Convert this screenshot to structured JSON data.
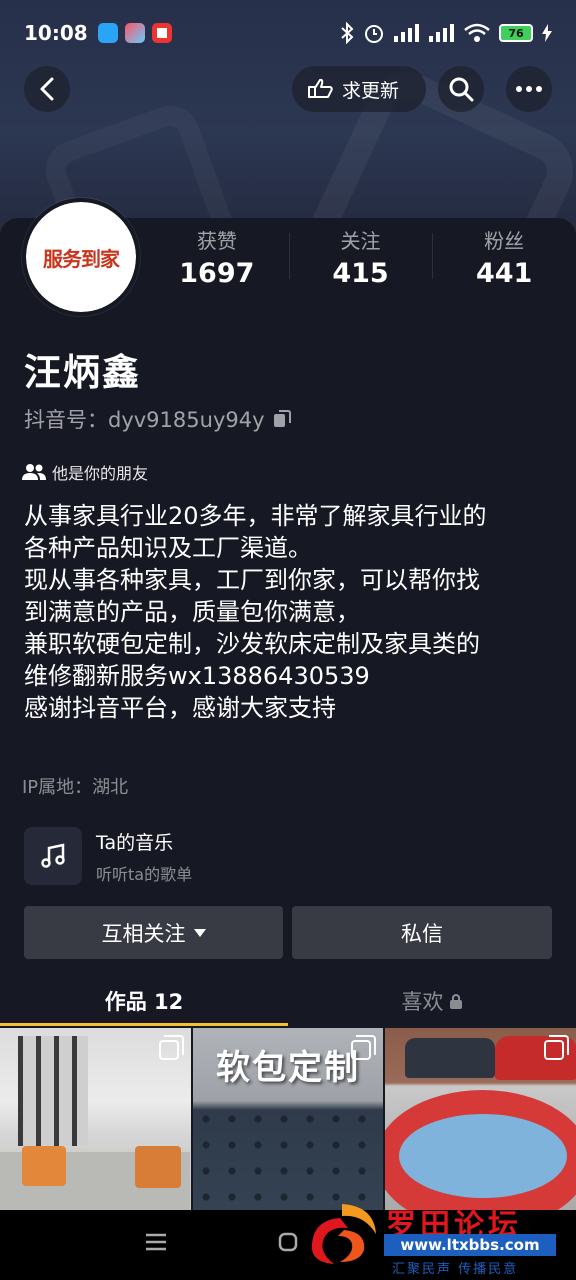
{
  "status_bar": {
    "time": "10:08",
    "battery": "76"
  },
  "topbar": {
    "request_update_label": "求更新"
  },
  "profile": {
    "avatar_text": "服务到家",
    "stats": [
      {
        "label": "获赞",
        "value": "1697"
      },
      {
        "label": "关注",
        "value": "415"
      },
      {
        "label": "粉丝",
        "value": "441"
      }
    ],
    "nickname": "汪炳鑫",
    "douyin_id": "抖音号：dyv9185uy94y",
    "friend_tag": "他是你的朋友",
    "bio_lines": [
      "从事家具行业20多年，非常了解家具行业的",
      "各种产品知识及工厂渠道。",
      "现从事各种家具，工厂到你家，可以帮你找",
      "到满意的产品，质量包你满意，",
      "兼职软硬包定制，沙发软床定制及家具类的",
      "维修翻新服务wx13886430539",
      "感谢抖音平台，感谢大家支持"
    ],
    "ip_location": "IP属地：湖北"
  },
  "music": {
    "title": "Ta的音乐",
    "subtitle": "听听ta的歌单"
  },
  "actions": {
    "follow_label": "互相关注",
    "message_label": "私信"
  },
  "tabs": {
    "works_label": "作品 12",
    "likes_label": "喜欢"
  },
  "grid": {
    "thumb2_label": "软包定制"
  },
  "watermark": {
    "title": "罗田论坛",
    "url": "www.ltxbbs.com",
    "slogan": "汇聚民声  传播民意"
  },
  "colors": {
    "background": "#161823",
    "accent_underline": "#f5c131",
    "button_bg": "#393b44"
  }
}
